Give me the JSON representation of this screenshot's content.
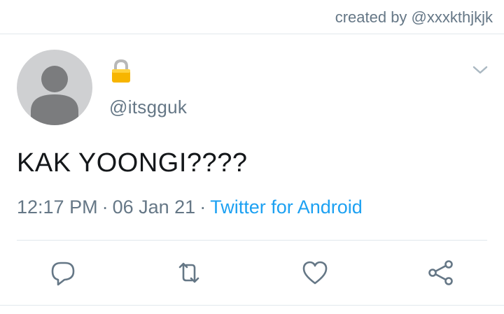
{
  "credit": "created by @xxxkthjkjk",
  "tweet": {
    "handle": "@itsgguk",
    "protected_icon": "lock-icon",
    "text": "KAK YOONGI????",
    "time": "12:17 PM",
    "separator": "·",
    "date": "06 Jan 21",
    "source": "Twitter for Android"
  },
  "actions": [
    "reply-icon",
    "retweet-icon",
    "like-icon",
    "share-icon"
  ],
  "colors": {
    "text": "#14171a",
    "secondary": "#657786",
    "link": "#1da1f2",
    "divider": "#e1e8ed",
    "avatar_bg": "#cfd0d2",
    "avatar_fg": "#7b7c7e",
    "lock": "#f7b500"
  }
}
